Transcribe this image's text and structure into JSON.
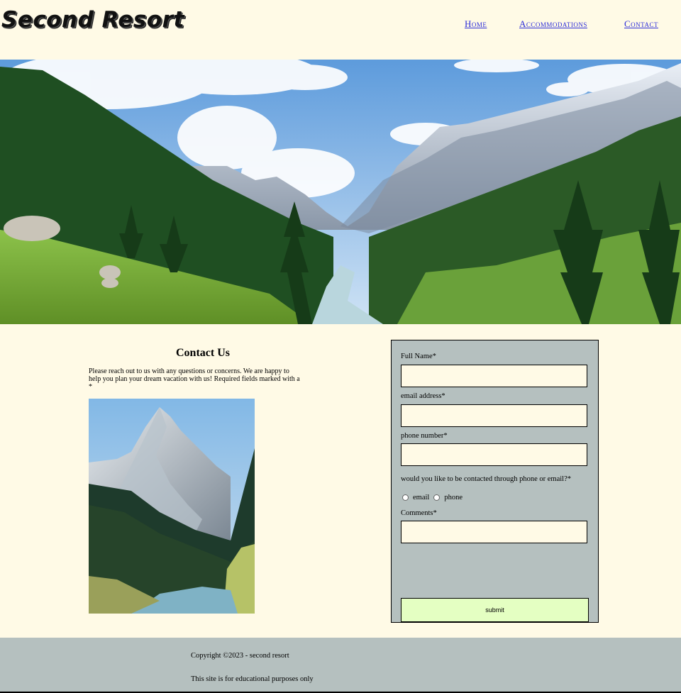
{
  "header": {
    "logo": "Second Resort",
    "nav": [
      {
        "label": "Home"
      },
      {
        "label": "Accommodations"
      },
      {
        "label": "Contact"
      }
    ]
  },
  "contact": {
    "title": "Contact Us",
    "text": "Please reach out to us with any questions or concerns. We are happy to help you plan your dream vacation with us! Required fields marked with a *"
  },
  "form": {
    "full_name_label": "Full Name*",
    "email_label": "email address*",
    "phone_label": "phone number*",
    "contact_pref_label": "would you like to be contacted through phone or email?*",
    "options": [
      "email",
      "phone"
    ],
    "comments_label": "Comments*",
    "submit_label": "submit",
    "values": {
      "full_name": "",
      "email": "",
      "phone": "",
      "comments": ""
    }
  },
  "footer": {
    "copyright": "Copyright ©2023 - second resort",
    "note": "This site is for educational purposes only"
  },
  "colors": {
    "page_bg": "#fffae6",
    "panel_bg": "#b5c0bf",
    "submit_bg": "#e4ffc2",
    "link": "#2b2bd8"
  }
}
